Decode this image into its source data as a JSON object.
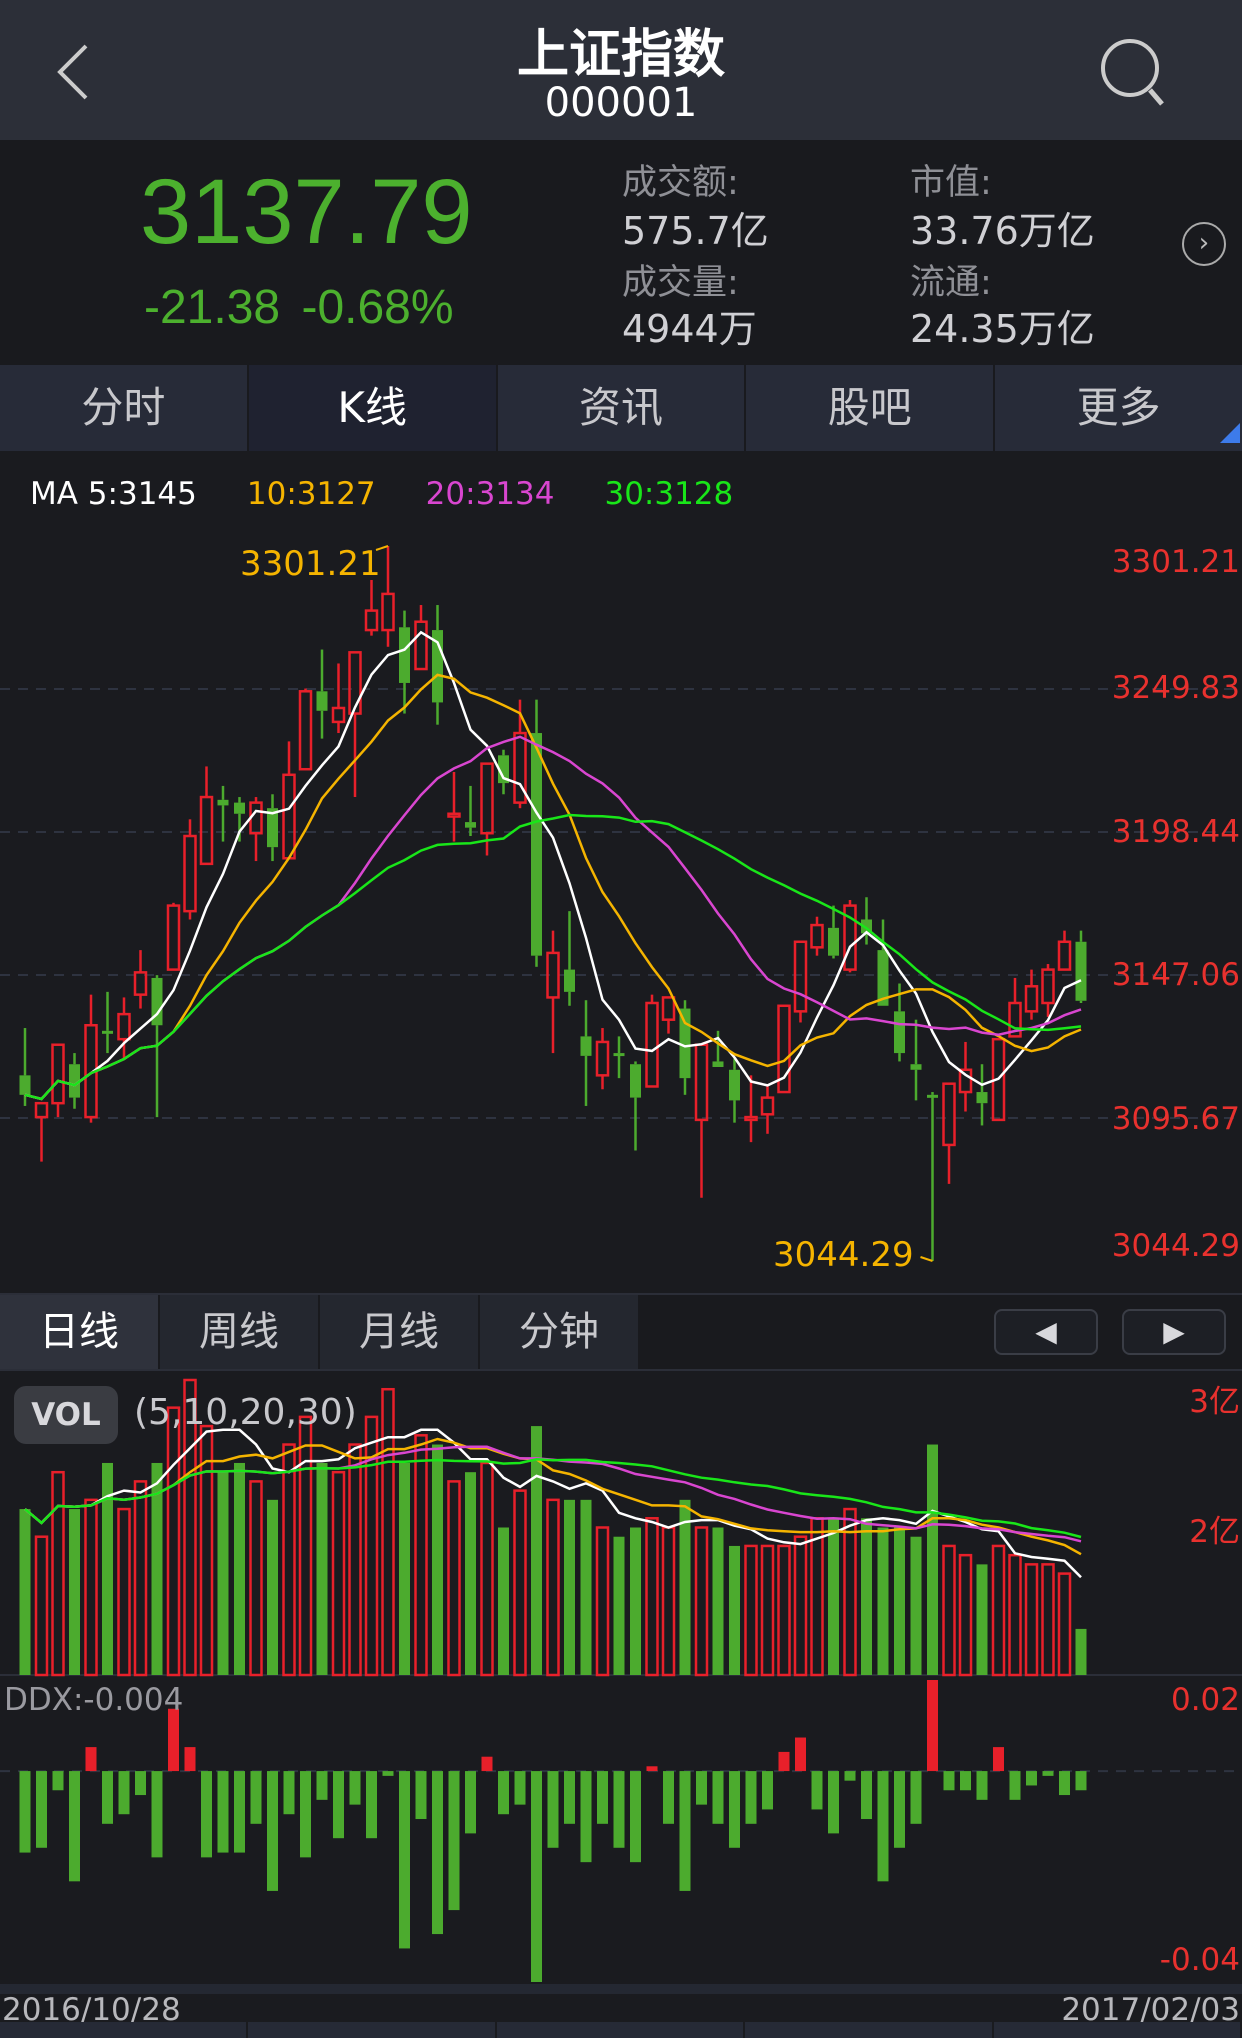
{
  "header": {
    "title": "上证指数",
    "code": "000001"
  },
  "quote": {
    "price": "3137.79",
    "change": "-21.38",
    "change_pct": "-0.68%",
    "turnover_label": "成交额:",
    "turnover": "575.7亿",
    "volume_label": "成交量:",
    "volume": "4944万",
    "mktcap_label": "市值:",
    "mktcap": "33.76万亿",
    "float_label": "流通:",
    "float": "24.35万亿"
  },
  "tabs": [
    {
      "label": "分时"
    },
    {
      "label": "K线"
    },
    {
      "label": "资讯"
    },
    {
      "label": "股吧"
    },
    {
      "label": "更多"
    }
  ],
  "period_tabs": [
    {
      "label": "日线"
    },
    {
      "label": "周线"
    },
    {
      "label": "月线"
    },
    {
      "label": "分钟"
    }
  ],
  "ma_legend": {
    "ma5": "MA 5:3145",
    "ma10": "10:3127",
    "ma20": "20:3134",
    "ma30": "30:3128"
  },
  "colors": {
    "up": "#e8202a",
    "down": "#4cab2e",
    "ma5": "#ffffff",
    "ma10": "#f5b400",
    "ma20": "#d946d0",
    "ma30": "#19e619",
    "axis": "#e8312e"
  },
  "chart_data": {
    "type": "candlestick",
    "price_axis": [
      "3301.21",
      "3249.83",
      "3198.44",
      "3147.06",
      "3095.67",
      "3044.29"
    ],
    "ylim": [
      3044.29,
      3301.21
    ],
    "annotations": {
      "high": "3301.21",
      "low": "3044.29"
    },
    "x_start": "2016/10/28",
    "x_end": "2017/02/03",
    "ohlc": [
      [
        3111,
        3128,
        3100,
        3104
      ],
      [
        3096,
        3101,
        3080,
        3101
      ],
      [
        3101,
        3122,
        3096,
        3122
      ],
      [
        3115,
        3119,
        3099,
        3103
      ],
      [
        3096,
        3140,
        3094,
        3129
      ],
      [
        3127,
        3141,
        3119,
        3126
      ],
      [
        3124,
        3139,
        3117,
        3133
      ],
      [
        3140,
        3156,
        3135,
        3148
      ],
      [
        3146,
        3147,
        3096,
        3129
      ],
      [
        3149,
        3173,
        3149,
        3172
      ],
      [
        3170,
        3203,
        3167,
        3197
      ],
      [
        3187,
        3222,
        3187,
        3211
      ],
      [
        3210,
        3215,
        3195,
        3208
      ],
      [
        3209,
        3211,
        3195,
        3205
      ],
      [
        3198,
        3211,
        3188,
        3209
      ],
      [
        3207,
        3212,
        3188,
        3193
      ],
      [
        3189,
        3231,
        3189,
        3219
      ],
      [
        3221,
        3250,
        3221,
        3249
      ],
      [
        3249,
        3264,
        3232,
        3242
      ],
      [
        3238,
        3259,
        3234,
        3243
      ],
      [
        3241,
        3263,
        3211,
        3263
      ],
      [
        3271,
        3289,
        3269,
        3278
      ],
      [
        3271,
        3301.21,
        3265,
        3284
      ],
      [
        3272,
        3278,
        3241,
        3252
      ],
      [
        3257,
        3280,
        3257,
        3274
      ],
      [
        3271,
        3280,
        3237,
        3245
      ],
      [
        3204,
        3220,
        3195,
        3205
      ],
      [
        3202,
        3215,
        3197,
        3200
      ],
      [
        3198,
        3223,
        3190,
        3223
      ],
      [
        3226,
        3228,
        3212,
        3216
      ],
      [
        3209,
        3246,
        3207,
        3234
      ],
      [
        3234,
        3246,
        3150,
        3154
      ],
      [
        3139,
        3163,
        3119,
        3155
      ],
      [
        3149,
        3170,
        3136,
        3141
      ],
      [
        3125,
        3138,
        3100,
        3118
      ],
      [
        3111,
        3128,
        3106,
        3123
      ],
      [
        3119,
        3125,
        3110,
        3118
      ],
      [
        3115,
        3116,
        3084,
        3103
      ],
      [
        3107,
        3140,
        3107,
        3137
      ],
      [
        3131,
        3139,
        3126,
        3139
      ],
      [
        3135,
        3138,
        3104,
        3110
      ],
      [
        3095,
        3122,
        3067,
        3122
      ],
      [
        3116,
        3127,
        3114,
        3114
      ],
      [
        3113,
        3117,
        3094,
        3102
      ],
      [
        3095,
        3111,
        3087,
        3096
      ],
      [
        3097,
        3107,
        3090,
        3103
      ],
      [
        3105,
        3136,
        3105,
        3136
      ],
      [
        3134,
        3159,
        3130,
        3159
      ],
      [
        3157,
        3168,
        3154,
        3165
      ],
      [
        3164,
        3172,
        3153,
        3154
      ],
      [
        3149,
        3174,
        3148,
        3172
      ],
      [
        3167,
        3175,
        3158,
        3162
      ],
      [
        3156,
        3167,
        3136,
        3136
      ],
      [
        3134,
        3144,
        3116,
        3119
      ],
      [
        3115,
        3131,
        3102,
        3113
      ],
      [
        3104,
        3105,
        3044.29,
        3103
      ],
      [
        3086,
        3108,
        3072,
        3108
      ],
      [
        3105,
        3123,
        3098,
        3113
      ],
      [
        3105,
        3115,
        3093,
        3101
      ],
      [
        3095,
        3124,
        3095,
        3124
      ],
      [
        3125,
        3146,
        3125,
        3137
      ],
      [
        3134,
        3149,
        3131,
        3143
      ],
      [
        3137,
        3151,
        3132,
        3149
      ],
      [
        3149,
        3163,
        3149,
        3159
      ],
      [
        3159,
        3163,
        3137,
        3137.79
      ]
    ],
    "volume": {
      "label": "VOL",
      "params": "(5,10,20,30)",
      "axis": [
        "3亿",
        "2亿"
      ],
      "ylim": [
        0,
        3.2
      ],
      "values": [
        1.8,
        1.5,
        2.2,
        1.8,
        1.9,
        2.3,
        1.8,
        2.1,
        2.3,
        2.9,
        3.2,
        2.7,
        2.2,
        2.3,
        2.1,
        1.9,
        2.5,
        2.8,
        2.3,
        2.2,
        2.5,
        2.8,
        3.1,
        2.3,
        2.6,
        2.5,
        2.1,
        2.2,
        2.3,
        1.6,
        2.0,
        2.7,
        1.9,
        1.9,
        1.9,
        1.6,
        1.5,
        1.6,
        1.7,
        1.6,
        1.9,
        1.6,
        1.6,
        1.4,
        1.4,
        1.4,
        1.4,
        1.5,
        1.7,
        1.7,
        1.8,
        1.7,
        1.6,
        1.6,
        1.5,
        2.5,
        1.4,
        1.3,
        1.2,
        1.4,
        1.3,
        1.2,
        1.2,
        1.1,
        0.5
      ]
    },
    "ddx": {
      "label": "DDX:-0.004",
      "axis": [
        "0.02",
        "-0.04"
      ],
      "ylim": [
        -0.044,
        0.019
      ],
      "values": [
        -0.017,
        -0.016,
        -0.004,
        -0.023,
        0.005,
        -0.011,
        -0.009,
        -0.005,
        -0.018,
        0.013,
        0.005,
        -0.018,
        -0.017,
        -0.017,
        -0.011,
        -0.025,
        -0.009,
        -0.018,
        -0.006,
        -0.014,
        -0.007,
        -0.014,
        -0.001,
        -0.037,
        -0.01,
        -0.034,
        -0.029,
        -0.013,
        0.003,
        -0.009,
        -0.007,
        -0.044,
        -0.016,
        -0.011,
        -0.019,
        -0.011,
        -0.016,
        -0.019,
        0.001,
        -0.011,
        -0.025,
        -0.007,
        -0.011,
        -0.016,
        -0.011,
        -0.008,
        0.004,
        0.007,
        -0.008,
        -0.013,
        -0.002,
        -0.01,
        -0.023,
        -0.016,
        -0.011,
        0.019,
        -0.004,
        -0.004,
        -0.006,
        0.005,
        -0.006,
        -0.003,
        -0.001,
        -0.005,
        -0.004
      ]
    }
  }
}
